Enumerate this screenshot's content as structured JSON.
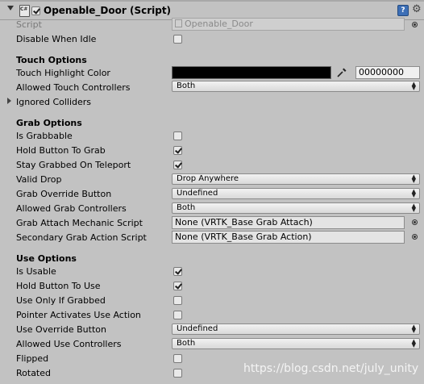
{
  "header": {
    "title": "Openable_Door (Script)",
    "enabled": true
  },
  "script_field": {
    "label": "Script",
    "value": "Openable_Door"
  },
  "disable_when_idle": {
    "label": "Disable When Idle",
    "checked": false
  },
  "touch_options": {
    "title": "Touch Options",
    "highlight_color": {
      "label": "Touch Highlight Color",
      "color": "#000000",
      "hex": "00000000"
    },
    "allowed_touch_controllers": {
      "label": "Allowed Touch Controllers",
      "value": "Both"
    },
    "ignored_colliders": {
      "label": "Ignored Colliders"
    }
  },
  "grab_options": {
    "title": "Grab Options",
    "is_grabbable": {
      "label": "Is Grabbable",
      "checked": false
    },
    "hold_button_to_grab": {
      "label": "Hold Button To Grab",
      "checked": true
    },
    "stay_grabbed_on_teleport": {
      "label": "Stay Grabbed On Teleport",
      "checked": true
    },
    "valid_drop": {
      "label": "Valid Drop",
      "value": "Drop Anywhere"
    },
    "grab_override_button": {
      "label": "Grab Override Button",
      "value": "Undefined"
    },
    "allowed_grab_controllers": {
      "label": "Allowed Grab Controllers",
      "value": "Both"
    },
    "grab_attach_mechanic_script": {
      "label": "Grab Attach Mechanic Script",
      "value": "None (VRTK_Base Grab Attach)"
    },
    "secondary_grab_action_script": {
      "label": "Secondary Grab Action Script",
      "value": "None (VRTK_Base Grab Action)"
    }
  },
  "use_options": {
    "title": "Use Options",
    "is_usable": {
      "label": "Is Usable",
      "checked": true
    },
    "hold_button_to_use": {
      "label": "Hold Button To Use",
      "checked": true
    },
    "use_only_if_grabbed": {
      "label": "Use Only If Grabbed",
      "checked": false
    },
    "pointer_activates_use_action": {
      "label": "Pointer Activates Use Action",
      "checked": false
    },
    "use_override_button": {
      "label": "Use Override Button",
      "value": "Undefined"
    },
    "allowed_use_controllers": {
      "label": "Allowed Use Controllers",
      "value": "Both"
    },
    "flipped": {
      "label": "Flipped",
      "checked": false
    },
    "rotated": {
      "label": "Rotated",
      "checked": false
    }
  },
  "watermark": "https://blog.csdn.net/july_unity"
}
